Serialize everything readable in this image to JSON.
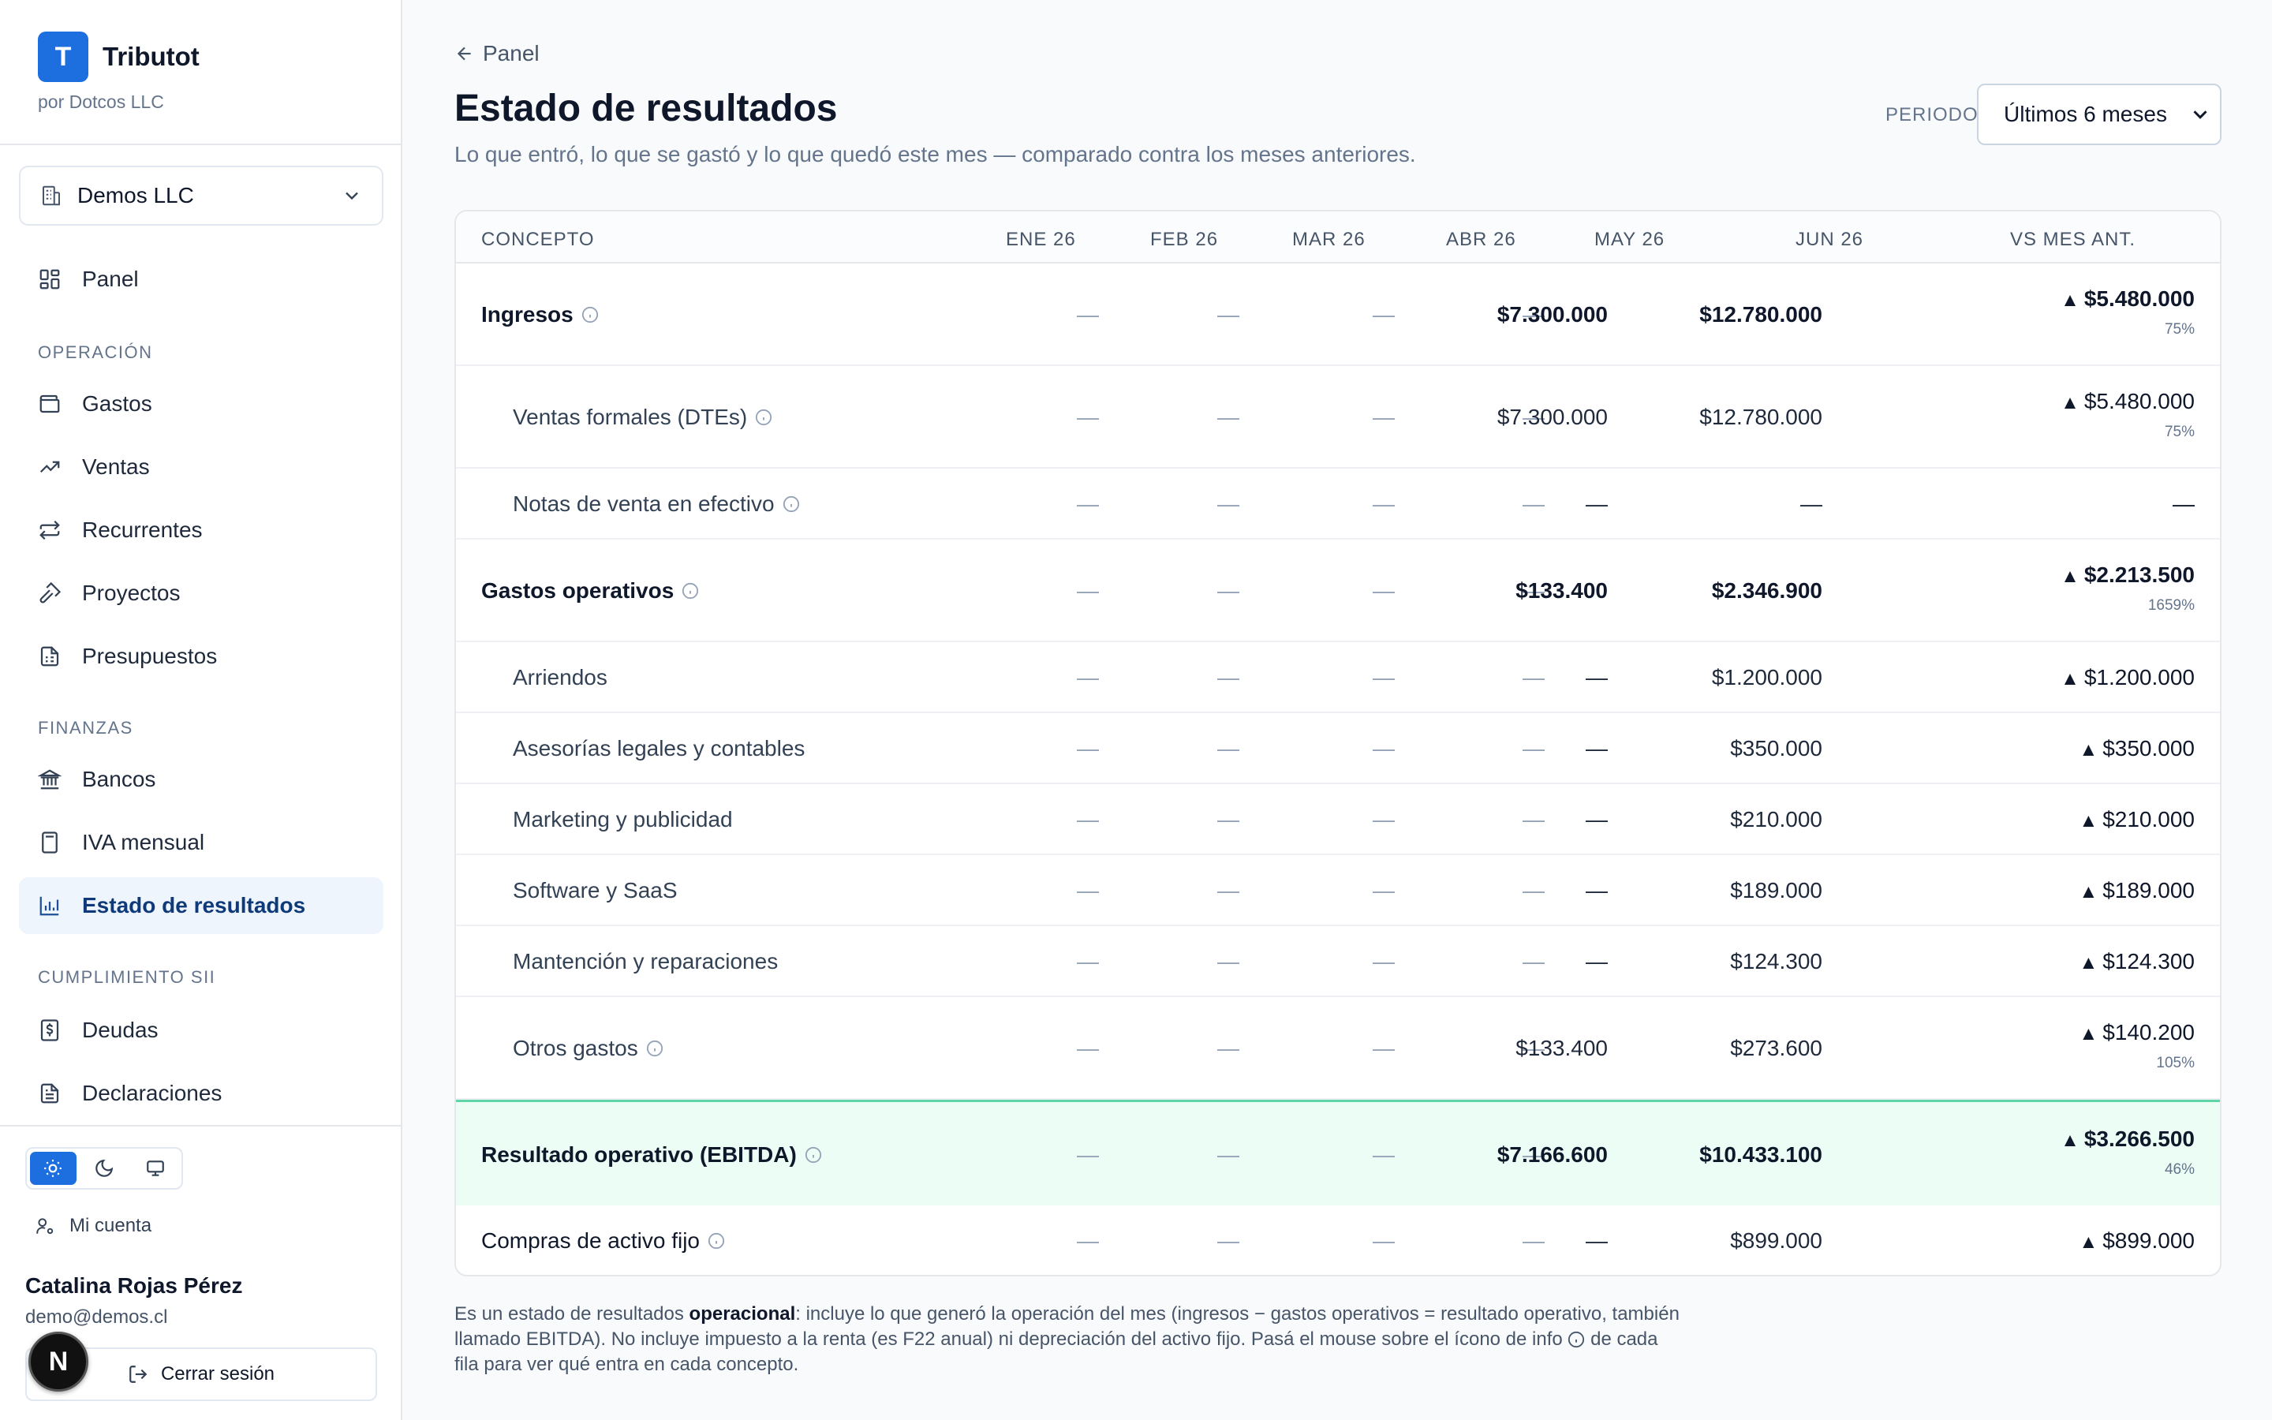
{
  "app": {
    "name": "Tributot",
    "logo_letter": "T",
    "subtitle": "por Dotcos LLC"
  },
  "company": {
    "name": "Demos LLC"
  },
  "nav": {
    "panel": "Panel",
    "section_operacion": "OPERACIÓN",
    "gastos": "Gastos",
    "ventas": "Ventas",
    "recurrentes": "Recurrentes",
    "proyectos": "Proyectos",
    "presupuestos": "Presupuestos",
    "section_finanzas": "FINANZAS",
    "bancos": "Bancos",
    "iva": "IVA mensual",
    "estado": "Estado de resultados",
    "section_cumplimiento": "CUMPLIMIENTO SII",
    "deudas": "Deudas",
    "declaraciones": "Declaraciones"
  },
  "footer": {
    "account": "Mi cuenta",
    "user_name": "Catalina Rojas Pérez",
    "user_email": "demo@demos.cl",
    "logout": "Cerrar sesión",
    "badge": "N"
  },
  "header": {
    "back": "Panel",
    "title": "Estado de resultados",
    "subtitle": "Lo que entró, lo que se gastó y lo que quedó este mes — comparado contra los meses anteriores.",
    "period_label": "PERIODO",
    "period_value": "Últimos 6 meses"
  },
  "table": {
    "columns": [
      "CONCEPTO",
      "ENE 26",
      "FEB 26",
      "MAR 26",
      "ABR 26",
      "MAY 26",
      "JUN 26",
      "VS MES ANT."
    ],
    "dash": "—",
    "rows": [
      {
        "label": "Ingresos",
        "may": "$7.300.000",
        "jun": "$12.780.000",
        "delta": "$5.480.000",
        "pct": "75%"
      },
      {
        "label": "Ventas formales (DTEs)",
        "may": "$7.300.000",
        "jun": "$12.780.000",
        "delta": "$5.480.000",
        "pct": "75%"
      },
      {
        "label": "Notas de venta en efectivo",
        "may": "—",
        "jun": "—",
        "delta": "—"
      },
      {
        "label": "Gastos operativos",
        "may": "$133.400",
        "jun": "$2.346.900",
        "delta": "$2.213.500",
        "pct": "1659%"
      },
      {
        "label": "Arriendos",
        "may": "—",
        "jun": "$1.200.000",
        "delta": "$1.200.000"
      },
      {
        "label": "Asesorías legales y contables",
        "may": "—",
        "jun": "$350.000",
        "delta": "$350.000"
      },
      {
        "label": "Marketing y publicidad",
        "may": "—",
        "jun": "$210.000",
        "delta": "$210.000"
      },
      {
        "label": "Software y SaaS",
        "may": "—",
        "jun": "$189.000",
        "delta": "$189.000"
      },
      {
        "label": "Mantención y reparaciones",
        "may": "—",
        "jun": "$124.300",
        "delta": "$124.300"
      },
      {
        "label": "Otros gastos",
        "may": "$133.400",
        "jun": "$273.600",
        "delta": "$140.200",
        "pct": "105%"
      },
      {
        "label": "Resultado operativo (EBITDA)",
        "may": "$7.166.600",
        "jun": "$10.433.100",
        "delta": "$3.266.500",
        "pct": "46%"
      },
      {
        "label": "Compras de activo fijo",
        "may": "—",
        "jun": "$899.000",
        "delta": "$899.000"
      }
    ]
  },
  "footnote": {
    "part1": "Es un estado de resultados ",
    "bold": "operacional",
    "part2": ": incluye lo que generó la operación del mes (ingresos − gastos operativos = resultado operativo, también llamado EBITDA). No incluye impuesto a la renta (es F22 anual) ni depreciación del activo fijo. Pasá el mouse sobre el ícono de info",
    "part3": " de cada fila para ver qué entra en cada concepto."
  },
  "colors": {
    "accent": "#1d6fe0",
    "ebitda_bg": "#ecfdf5",
    "ebitda_border": "#5dd5a6",
    "active_nav_bg": "#eff5fd"
  },
  "icons": {
    "nav": [
      "layout-grid-icon",
      "wallet-icon",
      "trending-up-icon",
      "repeat-icon",
      "hammer-icon",
      "document-icon",
      "bank-icon",
      "calculator-icon",
      "bar-chart-icon",
      "dollar-file-icon",
      "file-text-icon"
    ],
    "theme": [
      "sun-icon",
      "moon-icon",
      "monitor-icon"
    ]
  }
}
